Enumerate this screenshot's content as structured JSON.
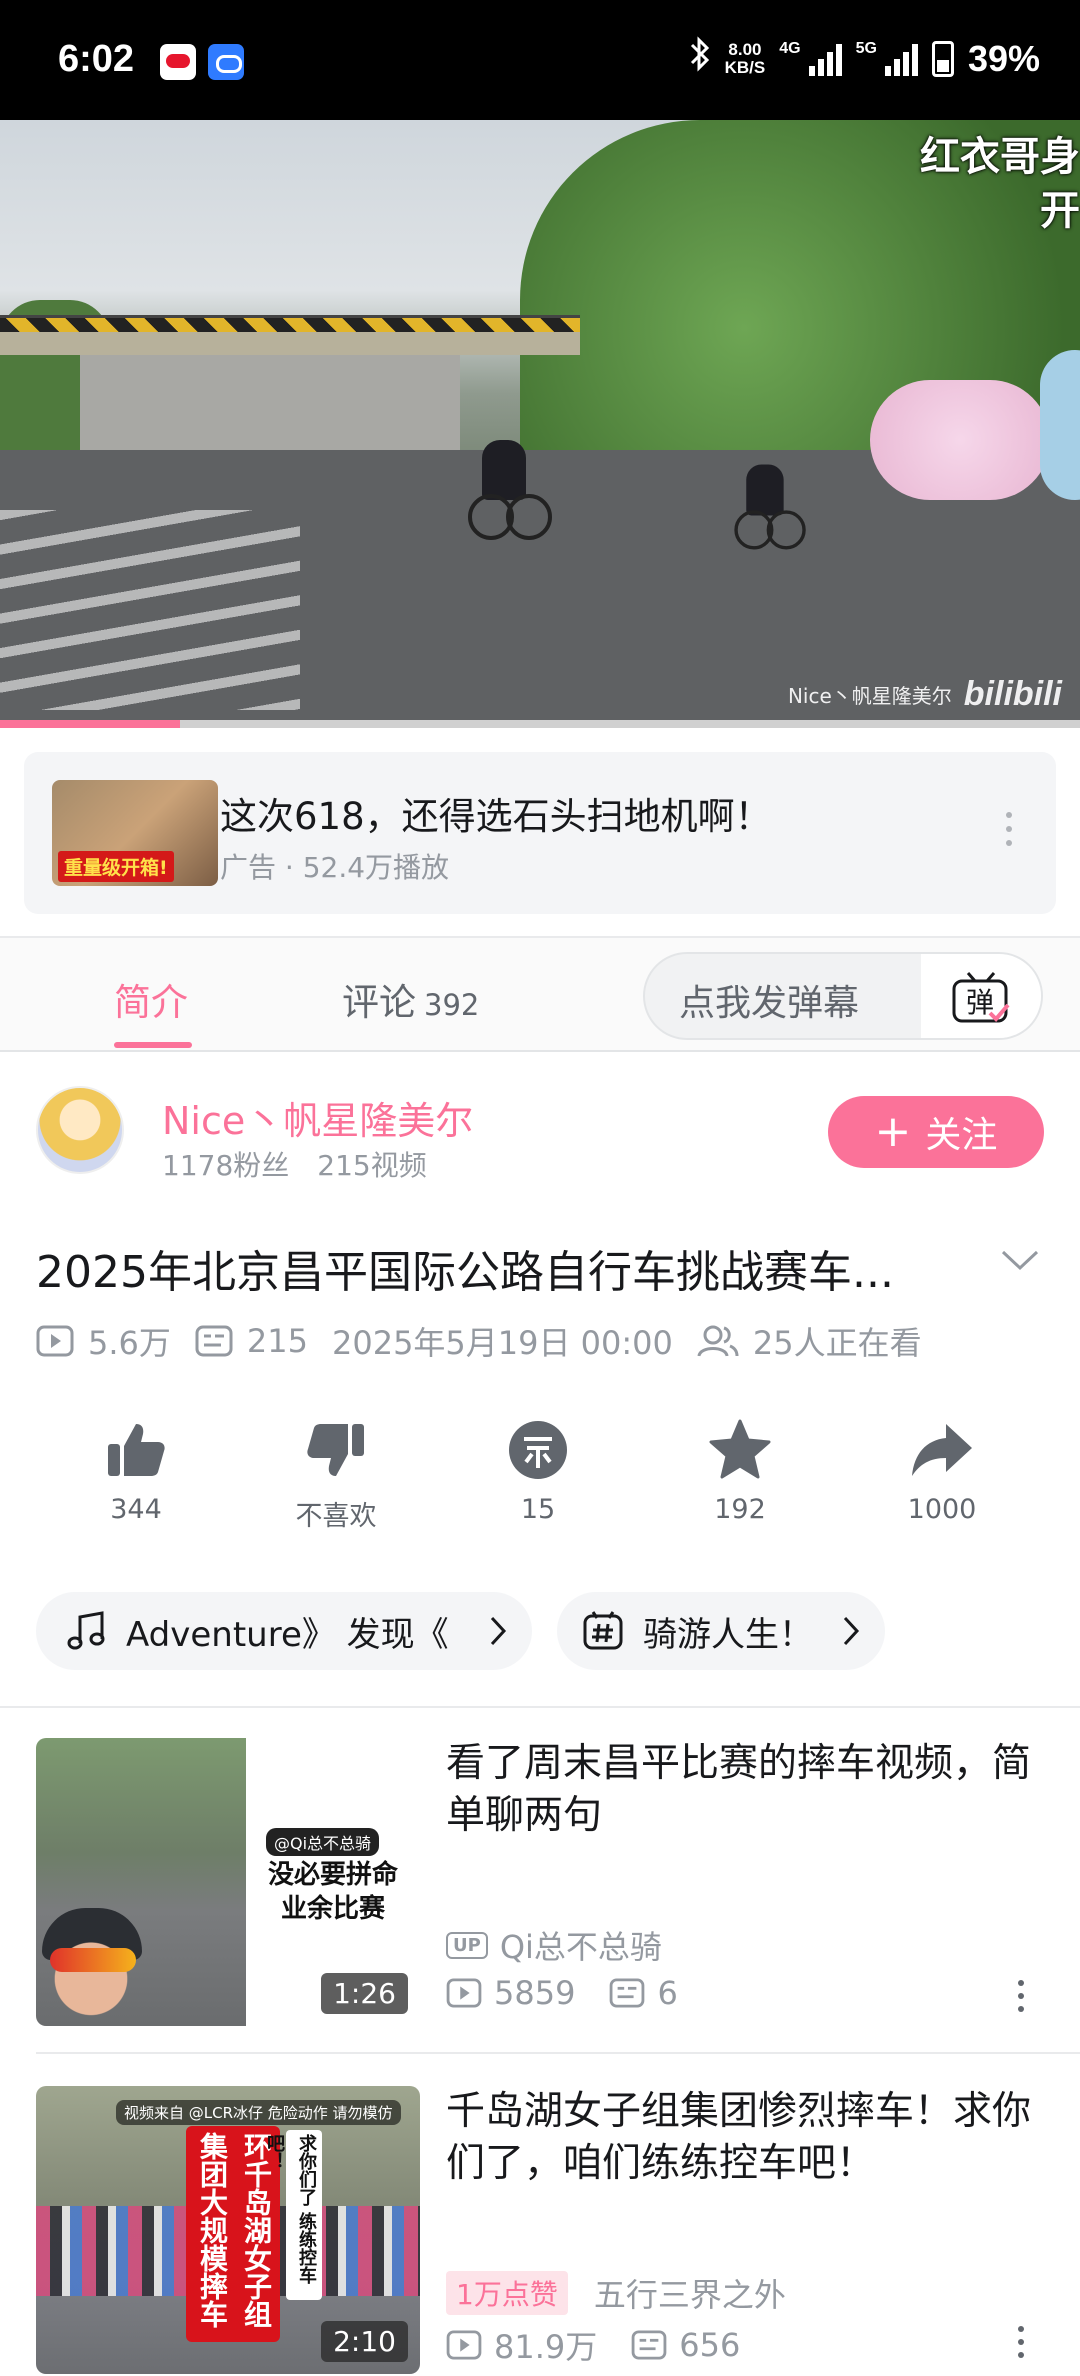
{
  "status_bar": {
    "time": "6:02",
    "net_speed_value": "8.00",
    "net_speed_unit": "KB/S",
    "net_4g": "4G",
    "net_5g": "5G",
    "battery": "39%",
    "icons": [
      "sina-weibo-icon",
      "cloud-app-icon",
      "bluetooth-icon",
      "signal-icon",
      "battery-icon"
    ]
  },
  "video": {
    "caption_lines": [
      "红衣哥身",
      "开"
    ],
    "watermark_user": "Nice丶帆星隆美尔",
    "watermark_logo": "bilibili",
    "progress": 0.167
  },
  "ad": {
    "thumb_tag": "重量级开箱!",
    "title": "这次618，还得选石头扫地机啊！",
    "meta": "广告 · 52.4万播放"
  },
  "tabs": {
    "intro": "简介",
    "comments": "评论",
    "comments_count": "392",
    "danmu_placeholder": "点我发弹幕",
    "danmu_button": "弹"
  },
  "uploader": {
    "name": "Nice丶帆星隆美尔",
    "fans": "1178粉丝",
    "videos": "215视频",
    "follow_label": "关注",
    "follow_plus": "+"
  },
  "video_info": {
    "title": "2025年北京昌平国际公路自行车挑战赛车...",
    "views": "5.6万",
    "danmaku": "215",
    "date": "2025年5月19日 00:00",
    "watching": "25人正在看"
  },
  "actions": {
    "like": "344",
    "dislike": "不喜欢",
    "coin": "15",
    "favorite": "192",
    "share": "1000"
  },
  "tags": {
    "music": "Adventure》   发现《",
    "topic": "骑游人生！"
  },
  "related": [
    {
      "title": "看了周末昌平比赛的摔车视频，简单聊两句",
      "author": "Qi总不总骑",
      "up_badge": "UP",
      "views": "5859",
      "danmaku": "6",
      "duration": "1:26",
      "thumb_user": "@Qi总不总骑",
      "thumb_text": "没必要拼命 业余比赛"
    },
    {
      "title": "千岛湖女子组集团惨烈摔车！求你们了，咱们练练控车吧！",
      "like_badge": "1万点赞",
      "author": "五行三界之外",
      "views": "81.9万",
      "danmaku": "656",
      "duration": "2:10",
      "thumb_source": "视频来自 @LCR冰仔 危险动作 请勿模仿",
      "thumb_red_text": "环千岛湖女子组集团大规模摔车",
      "thumb_white_text": "求你们了 练练控车吧！"
    }
  ],
  "colors": {
    "accent": "#fb7299",
    "text_primary": "#18191c",
    "text_secondary": "#9499a0",
    "icon_gray": "#61666d"
  }
}
